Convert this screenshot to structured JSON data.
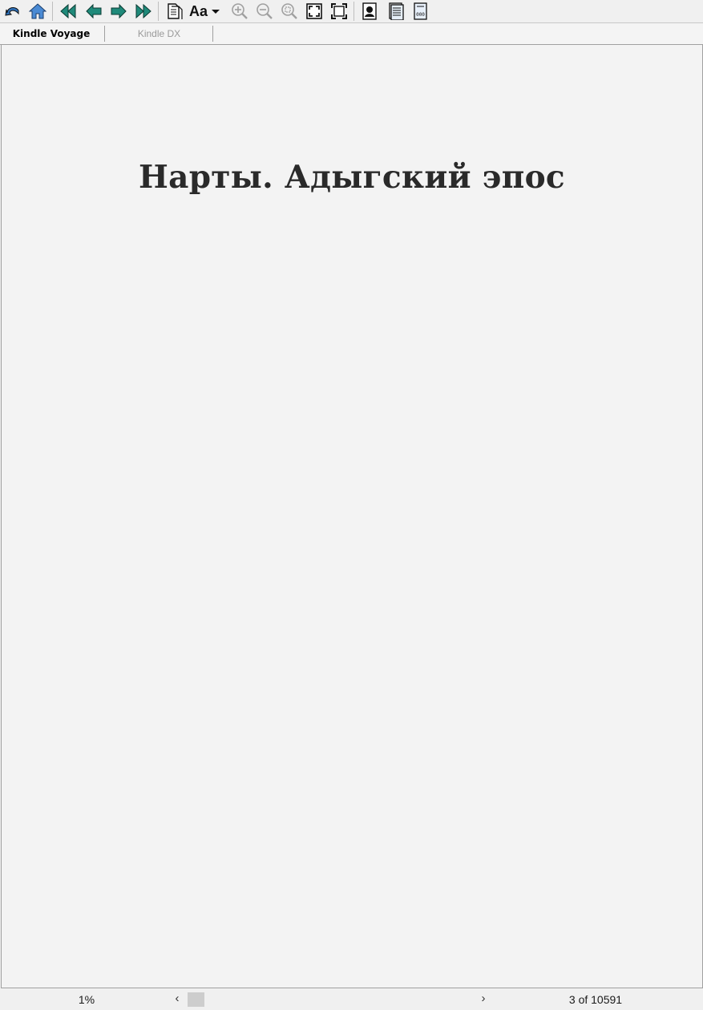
{
  "tabs": [
    {
      "label": "Kindle Voyage",
      "active": true
    },
    {
      "label": "Kindle DX",
      "active": false
    }
  ],
  "toolbar": {
    "font_button_label": "Aa",
    "icons": [
      "undo-icon",
      "home-icon",
      "first-page-icon",
      "previous-page-icon",
      "next-page-icon",
      "last-page-icon",
      "page-setup-icon",
      "font-icon",
      "zoom-in-icon",
      "zoom-out-icon",
      "zoom-reset-icon",
      "fit-screen-icon",
      "fit-width-icon",
      "cover-view-icon",
      "text-view-icon",
      "book-info-icon"
    ]
  },
  "page": {
    "title": "Нарты. Адыгский эпос"
  },
  "status": {
    "percent": "1%",
    "page_indicator": "3 of 10591",
    "scroll_position": 0.01
  },
  "colors": {
    "nav_teal": "#1f8a7a",
    "home_blue": "#3a7bc8"
  }
}
